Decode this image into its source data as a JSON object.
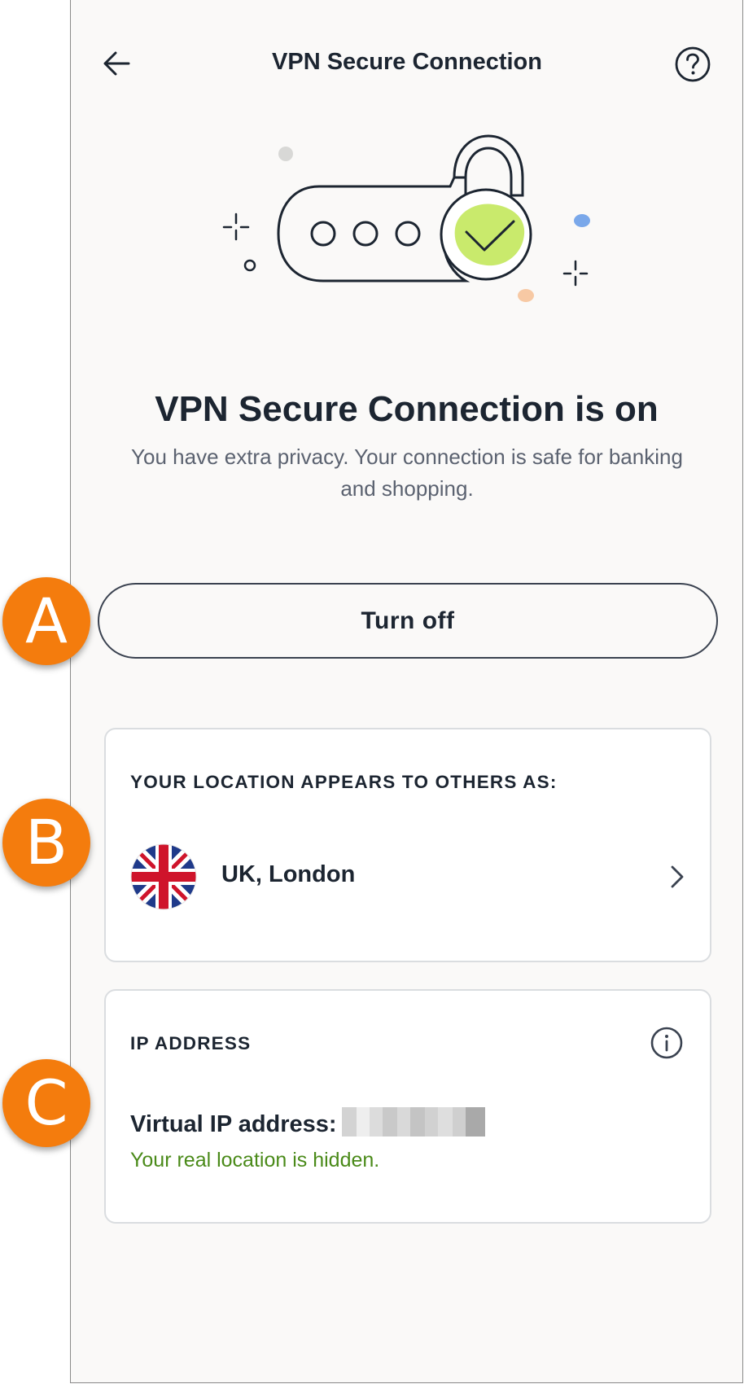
{
  "header": {
    "title": "VPN Secure Connection",
    "back_icon": "arrow-left-icon",
    "help_icon": "question-circle-icon"
  },
  "hero": {
    "illustration": "padlock-checkmark-illustration",
    "accent_color": "#c9ea6c"
  },
  "status": {
    "title": "VPN Secure Connection is on",
    "subtitle": "You have extra privacy. Your connection is safe for banking and shopping."
  },
  "actions": {
    "turn_off_label": "Turn off"
  },
  "location_card": {
    "heading": "YOUR LOCATION APPEARS TO OTHERS AS:",
    "location": "UK, London",
    "flag_icon": "uk-flag-icon",
    "chevron_icon": "chevron-right-icon"
  },
  "ip_card": {
    "heading": "IP ADDRESS",
    "label": "Virtual IP address:",
    "note": "Your real location is hidden.",
    "note_color": "#4a8a19",
    "info_icon": "info-circle-icon"
  },
  "annotations": {
    "a": "A",
    "b": "B",
    "c": "C",
    "badge_color": "#f47c0d"
  }
}
